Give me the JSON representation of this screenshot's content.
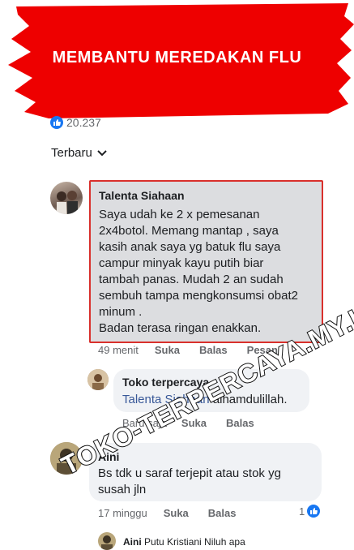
{
  "banner": {
    "title": "MEMBANTU MEREDAKAN FLU",
    "color": "#ee0000"
  },
  "reactions": {
    "count": "20.237",
    "icon": "like-icon"
  },
  "sort": {
    "label": "Terbaru",
    "icon": "chevron-down-icon"
  },
  "comments": [
    {
      "name": "Talenta Siahaan",
      "lines": [
        "Saya udah ke 2 x pemesanan",
        "2x4botol. Memang mantap  , saya",
        "kasih anak saya yg batuk flu saya",
        "campur minyak kayu putih biar",
        "tambah panas. Mudah 2 an sudah",
        "sembuh tampa mengkonsumsi obat2",
        "minum .",
        "Badan terasa ringan enakkan."
      ],
      "time": "49 menit",
      "like": "Suka",
      "reply": "Balas",
      "order": "Pesan"
    },
    {
      "name": "Toko terpercaya",
      "mention": "Talenta Siahaan",
      "text": "alhamdulillah.",
      "time": "Baru saja",
      "like": "Suka",
      "reply": "Balas"
    },
    {
      "name": "Aini",
      "lines": [
        "Bs tdk u saraf terjepit atau stok yg",
        "susah jln"
      ],
      "time": "17 minggu",
      "like": "Suka",
      "reply": "Balas",
      "likes": "1"
    },
    {
      "name": "Aini",
      "preview": "Putu Kristiani Niluh apa"
    }
  ],
  "watermark": "TOKO-TERPERCAYA.MY.ID",
  "colors": {
    "highlight_border": "#d9302c",
    "link": "#385898",
    "like_blue": "#1877f2"
  }
}
